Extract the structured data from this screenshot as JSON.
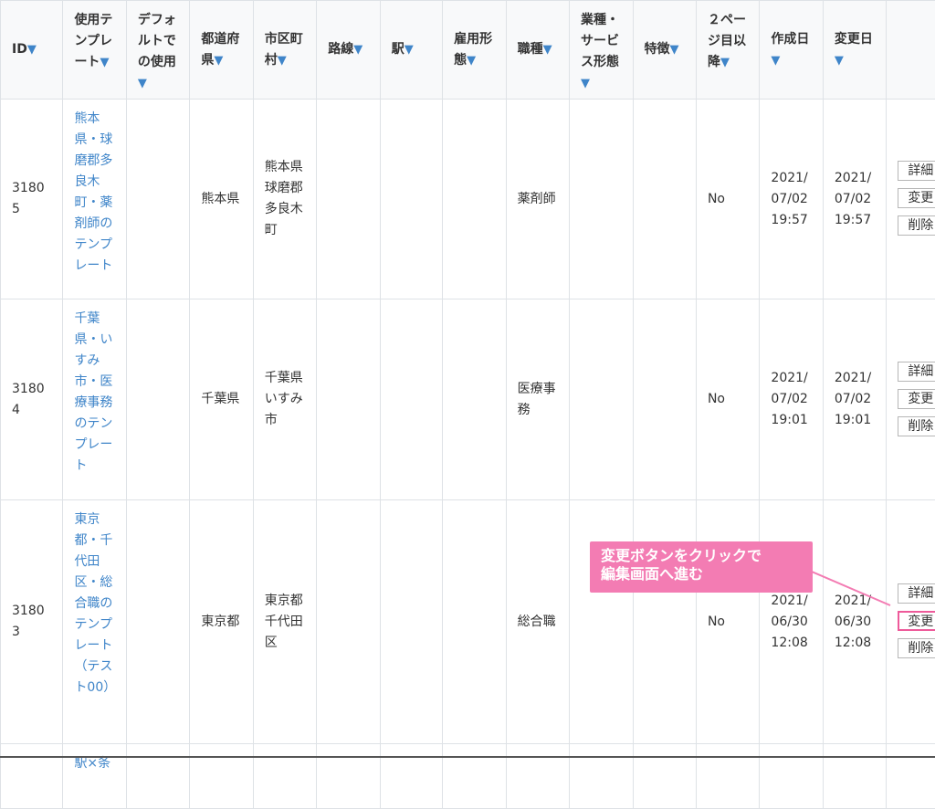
{
  "headers": [
    {
      "name": "col-header-id",
      "label": "ID"
    },
    {
      "name": "col-header-template",
      "label": "使用テンプレート"
    },
    {
      "name": "col-header-default",
      "label": "デフォルトでの使用"
    },
    {
      "name": "col-header-prefecture",
      "label": "都道府県"
    },
    {
      "name": "col-header-city",
      "label": "市区町村"
    },
    {
      "name": "col-header-route",
      "label": "路線"
    },
    {
      "name": "col-header-station",
      "label": "駅"
    },
    {
      "name": "col-header-employment",
      "label": "雇用形態"
    },
    {
      "name": "col-header-job",
      "label": "職種"
    },
    {
      "name": "col-header-industry",
      "label": "業種・サービス形態"
    },
    {
      "name": "col-header-feature",
      "label": "特徴"
    },
    {
      "name": "col-header-page2",
      "label": "２ページ目以降"
    },
    {
      "name": "col-header-created",
      "label": "作成日"
    },
    {
      "name": "col-header-updated",
      "label": "変更日"
    }
  ],
  "sort_glyph": "▼",
  "rows": [
    {
      "id": "31805",
      "template": "熊本県・球磨郡多良木町・薬剤師のテンプレート",
      "prefecture": "熊本県",
      "city": "熊本県球磨郡多良木町",
      "job": "薬剤師",
      "page2": "No",
      "created": "2021/07/02 19:57",
      "updated": "2021/07/02 19:57"
    },
    {
      "id": "31804",
      "template": "千葉県・いすみ市・医療事務のテンプレート",
      "prefecture": "千葉県",
      "city": "千葉県いすみ市",
      "job": "医療事務",
      "page2": "No",
      "created": "2021/07/02 19:01",
      "updated": "2021/07/02 19:01"
    },
    {
      "id": "31803",
      "template": "東京都・千代田区・総合職のテンプレート（テスト00）",
      "prefecture": "東京都",
      "city": "東京都千代田区",
      "job": "総合職",
      "page2": "No",
      "created": "2021/06/30 12:08",
      "updated": "2021/06/30 12:08"
    },
    {
      "template": "駅×条"
    }
  ],
  "buttons": {
    "detail": "詳細",
    "edit": "変更",
    "delete": "削除"
  },
  "callout": {
    "line1": "変更ボタンをクリックで",
    "line2": "編集画面へ進む"
  },
  "colors": {
    "link": "#3f85c9",
    "callout": "#f37cb3",
    "highlight": "#ee5a9a"
  }
}
